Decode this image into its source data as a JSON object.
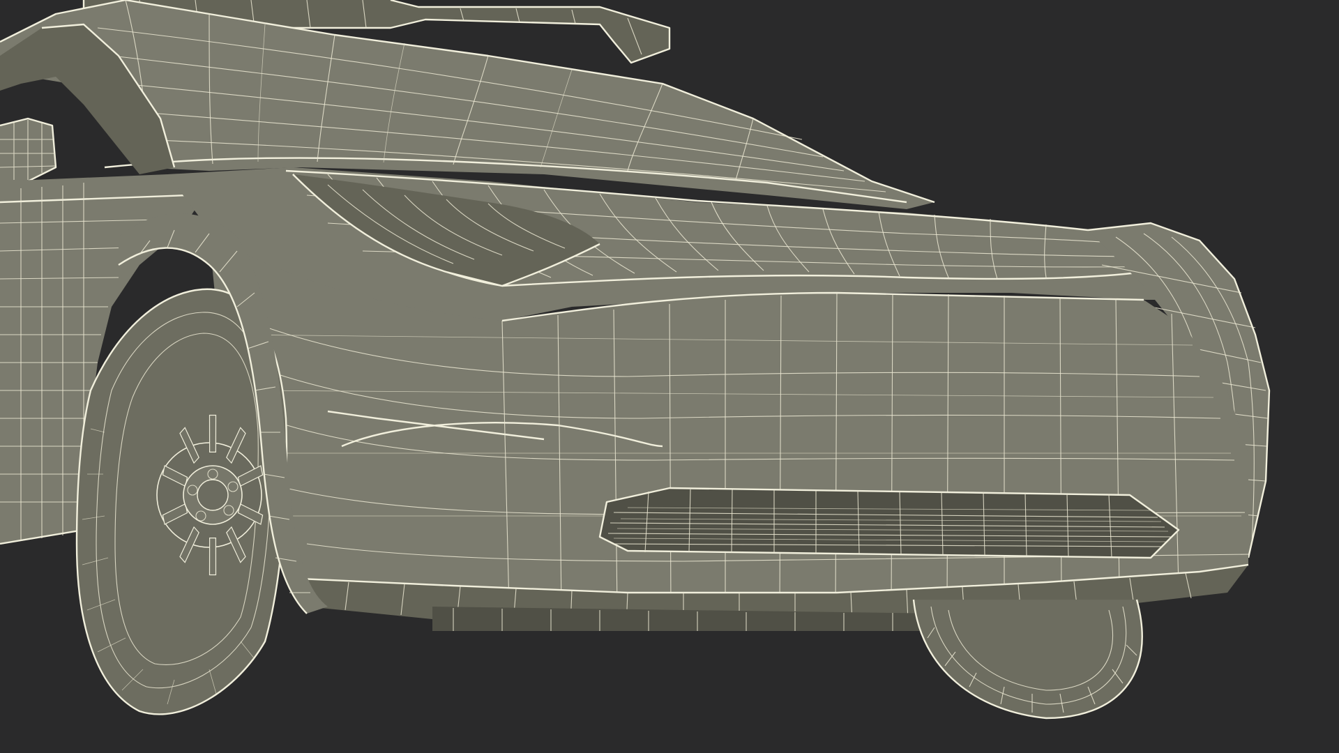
{
  "scene": {
    "subject": "car-wireframe-render",
    "colors": {
      "background": "#2a2a2b",
      "surface": "#7b7b6e",
      "surface_shadow": "#646457",
      "wire": "#f1efdc"
    },
    "wheel_spokes": 10
  }
}
